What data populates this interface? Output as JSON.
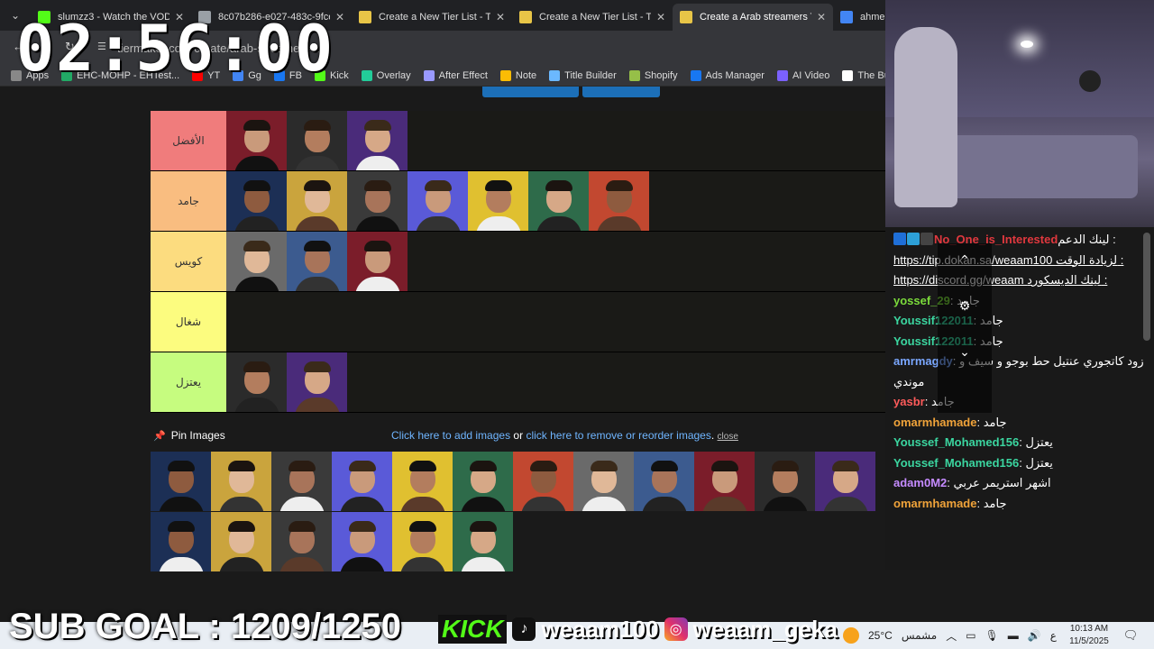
{
  "browser": {
    "tabs": [
      {
        "title": "slumzz3 - Watch the VOD",
        "icon": "kick-icon",
        "color": "#53fc18",
        "active": false
      },
      {
        "title": "8c07b286-e027-483c-9fce",
        "icon": "globe-icon",
        "color": "#9aa0a6",
        "active": false
      },
      {
        "title": "Create a New Tier List - Tie",
        "icon": "tiermaker-icon",
        "color": "#e8c547",
        "active": false
      },
      {
        "title": "Create a New Tier List - Tie",
        "icon": "tiermaker-icon",
        "color": "#e8c547",
        "active": false
      },
      {
        "title": "Create a Arab streamers Ti",
        "icon": "tiermaker-icon",
        "color": "#e8c547",
        "active": true
      },
      {
        "title": "ahmeds",
        "icon": "google-icon",
        "color": "#4285f4",
        "active": false
      }
    ],
    "url": "tiermaker.com/create/arab-streamers-...",
    "bookmarks": [
      {
        "label": "Apps",
        "color": "#888"
      },
      {
        "label": "EHC-MOHP - EHTest...",
        "color": "#2a6"
      },
      {
        "label": "YT",
        "color": "#f00"
      },
      {
        "label": "Gg",
        "color": "#4285f4"
      },
      {
        "label": "FB",
        "color": "#1877f2"
      },
      {
        "label": "Kick",
        "color": "#53fc18"
      },
      {
        "label": "Overlay",
        "color": "#2c9"
      },
      {
        "label": "After Effect",
        "color": "#9999ff"
      },
      {
        "label": "Note",
        "color": "#fbbc04"
      },
      {
        "label": "Title Builder",
        "color": "#6bb8ff"
      },
      {
        "label": "Shopify",
        "color": "#96bf48"
      },
      {
        "label": "Ads Manager",
        "color": "#1877f2"
      },
      {
        "label": "AI Video",
        "color": "#7b61ff"
      },
      {
        "label": "The Busin",
        "color": "#fff"
      }
    ]
  },
  "tiers": [
    {
      "label": "الأفضل",
      "color": "#f07c7c",
      "images": 3
    },
    {
      "label": "جامد",
      "color": "#f9bd80",
      "images": 7
    },
    {
      "label": "كويس",
      "color": "#fcdc7f",
      "images": 3
    },
    {
      "label": "شغال",
      "color": "#fcfc7f",
      "images": 0
    },
    {
      "label": "يعتزل",
      "color": "#c6fc7f",
      "images": 2
    }
  ],
  "pin": {
    "pin_label": "Pin Images",
    "add_link": "Click here to add images",
    "or_text": "or",
    "remove_link": "click here to remove or reorder images",
    "period": ".",
    "close": "close"
  },
  "pool_counts": [
    12,
    6
  ],
  "chat": [
    {
      "user": "No_One_is_Interested",
      "user_color": "#e0383e",
      "text": "لينك الدعم :"
    },
    {
      "user": "",
      "user_color": "#fff",
      "text": "https://tip.dokan.sa/weaam100 لزيادة الوقت :"
    },
    {
      "user": "",
      "user_color": "#fff",
      "text": "https://discord.gg/weaam لينك الديسكورد :"
    },
    {
      "user": "yossef_29",
      "user_color": "#7bdb3b",
      "text": ": جامد"
    },
    {
      "user": "Youssif122011",
      "user_color": "#3bd6a0",
      "text": ": جامد"
    },
    {
      "user": "Youssif122011",
      "user_color": "#3bd6a0",
      "text": ": جامد"
    },
    {
      "user": "amrmagdy",
      "user_color": "#7aa7ff",
      "text": ": زود كاتجوري عنتيل حط بوجو و سيف و"
    },
    {
      "user": "",
      "user_color": "#fff",
      "text": "موندي"
    },
    {
      "user": "yasbr",
      "user_color": "#ff5b5b",
      "text": ": جامد"
    },
    {
      "user": "omarmhamade",
      "user_color": "#f0a33a",
      "text": ": جامد"
    },
    {
      "user": "Youssef_Mohamed156",
      "user_color": "#3bd6a0",
      "text": ": يعتزل"
    },
    {
      "user": "Youssef_Mohamed156",
      "user_color": "#3bd6a0",
      "text": ": يعتزل"
    },
    {
      "user": "adam0M2",
      "user_color": "#c58bff",
      "text": ": اشهر استريمر عربي"
    },
    {
      "user": "omarmhamade",
      "user_color": "#f0a33a",
      "text": ": جامد"
    }
  ],
  "overlay": {
    "timer": "02:56:00",
    "sub_goal": "SUB GOAL : 1209/1250",
    "kick_label": "KICK",
    "kick_name": "weaam100",
    "instagram_name": "weaam_geka"
  },
  "taskbar": {
    "temp": "25°C",
    "weather": "مشمس",
    "lang": "ع",
    "time": "10:13 AM",
    "date": "11/5/2025"
  }
}
